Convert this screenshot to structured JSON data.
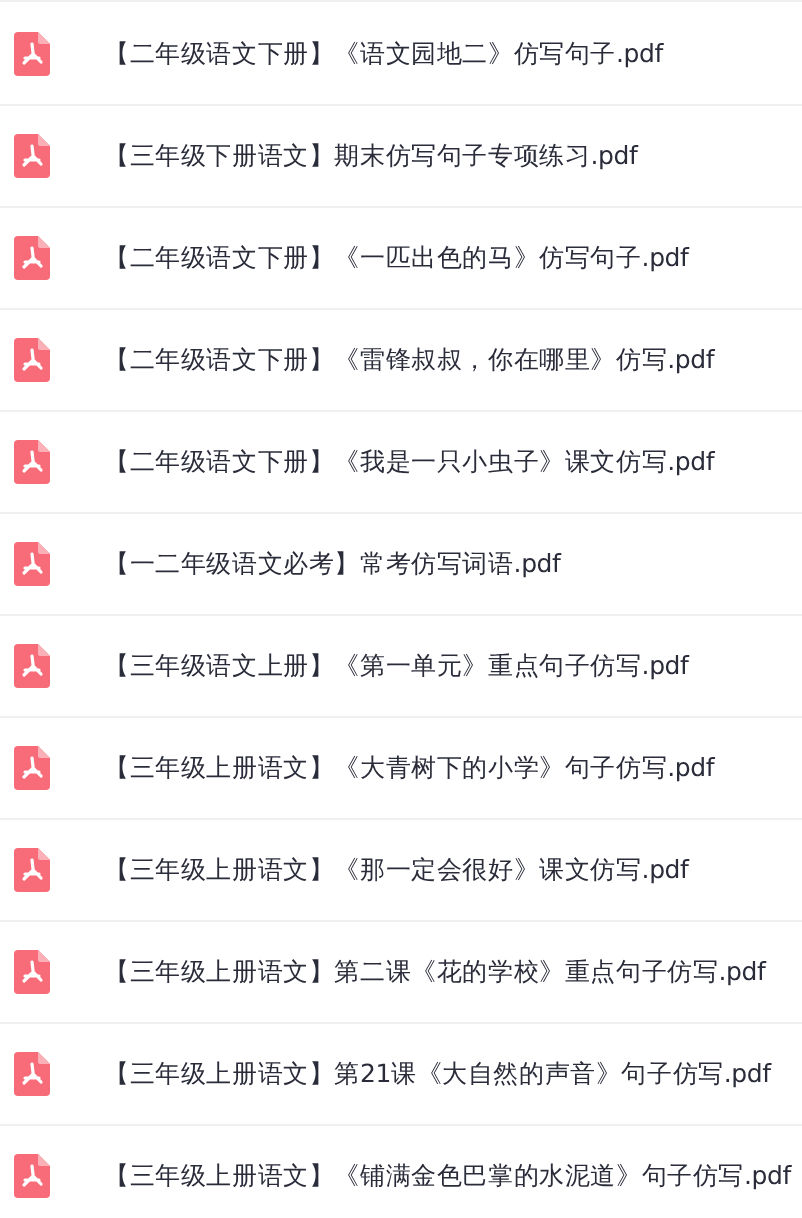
{
  "files": [
    {
      "name": "【二年级语文下册】《语文园地二》仿写句子.pdf"
    },
    {
      "name": "【三年级下册语文】期末仿写句子专项练习.pdf"
    },
    {
      "name": "【二年级语文下册】《一匹出色的马》仿写句子.pdf"
    },
    {
      "name": "【二年级语文下册】《雷锋叔叔，你在哪里》仿写.pdf"
    },
    {
      "name": "【二年级语文下册】《我是一只小虫子》课文仿写.pdf"
    },
    {
      "name": "【一二年级语文必考】常考仿写词语.pdf"
    },
    {
      "name": "【三年级语文上册】《第一单元》重点句子仿写.pdf"
    },
    {
      "name": "【三年级上册语文】《大青树下的小学》句子仿写.pdf"
    },
    {
      "name": "【三年级上册语文】《那一定会很好》课文仿写.pdf"
    },
    {
      "name": "【三年级上册语文】第二课《花的学校》重点句子仿写.pdf"
    },
    {
      "name": "【三年级上册语文】第21课《大自然的声音》句子仿写.pdf"
    },
    {
      "name": "【三年级上册语文】《铺满金色巴掌的水泥道》句子仿写.pdf"
    }
  ]
}
